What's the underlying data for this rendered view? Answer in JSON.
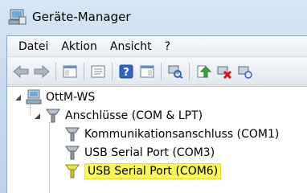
{
  "window": {
    "title": "Geräte-Manager"
  },
  "menu": {
    "items": [
      "Datei",
      "Aktion",
      "Ansicht",
      "?"
    ]
  },
  "toolbar": {
    "buttons": [
      "back-arrow-icon",
      "forward-arrow-icon",
      "show-hide-tree-icon",
      "properties-icon",
      "help-icon",
      "show-hide-console-icon",
      "scan-hardware-icon",
      "update-driver-icon",
      "disable-device-icon",
      "uninstall-device-icon"
    ]
  },
  "tree": {
    "computer": "OttM-WS",
    "category": "Anschlüsse (COM & LPT)",
    "devices": [
      "Kommunikationsanschluss (COM1)",
      "USB Serial Port (COM3)",
      "USB Serial Port (COM6)"
    ],
    "selected_index": 2
  },
  "colors": {
    "highlight": "#fbf75a",
    "titlebar": "#c9dcf1"
  }
}
